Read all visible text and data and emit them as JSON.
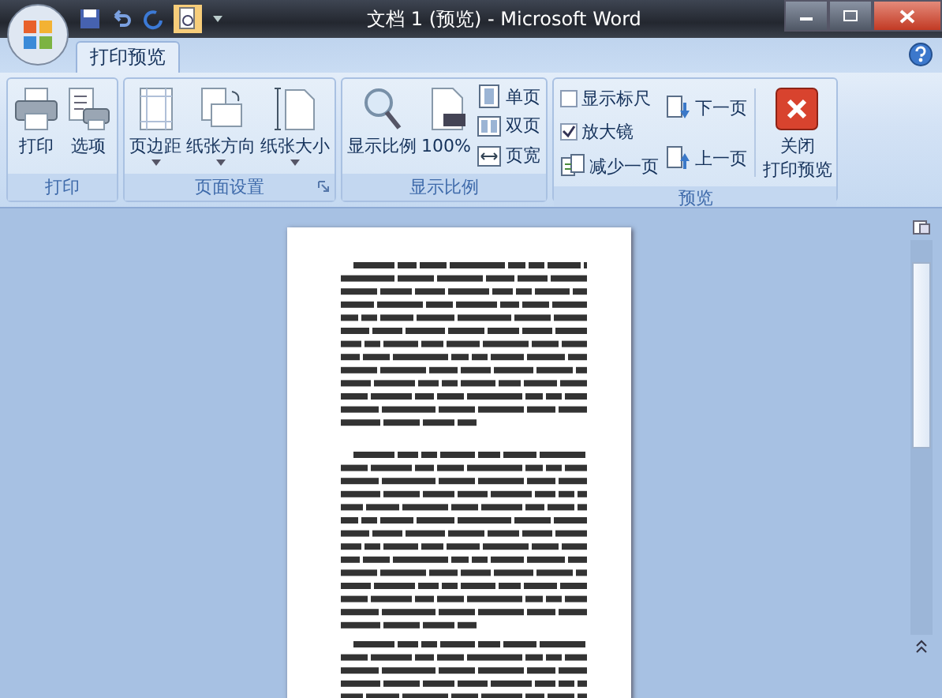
{
  "window": {
    "title": "文档 1 (预览) - Microsoft Word"
  },
  "tabs": [
    {
      "label": "打印预览",
      "selected": true
    }
  ],
  "groups": [
    {
      "label": "打印",
      "items": [
        {
          "kind": "big",
          "label": "打印"
        },
        {
          "kind": "big",
          "label": "选项"
        }
      ]
    },
    {
      "label": "页面设置",
      "items": [
        {
          "kind": "dropdown",
          "label": "页边距"
        },
        {
          "kind": "dropdown",
          "label": "纸张方向"
        },
        {
          "kind": "dropdown",
          "label": "纸张大小"
        }
      ]
    },
    {
      "label": "显示比例",
      "items": [
        {
          "kind": "big",
          "label": "显示比例"
        },
        {
          "kind": "big",
          "label": "100%"
        },
        {
          "kind": "stack",
          "items": [
            {
              "kind": "small",
              "label": "单页"
            },
            {
              "kind": "small",
              "label": "双页"
            },
            {
              "kind": "small",
              "label": "页宽"
            }
          ]
        }
      ]
    },
    {
      "label": "预览",
      "items": [
        {
          "kind": "stack",
          "items": [
            {
              "kind": "checkbox",
              "label": "显示标尺",
              "checked": false
            },
            {
              "kind": "checkbox",
              "label": "放大镜",
              "checked": true
            },
            {
              "kind": "small",
              "label": "减少一页"
            }
          ]
        },
        {
          "kind": "stack",
          "items": [
            {
              "kind": "small",
              "label": "下一页"
            },
            {
              "kind": "small",
              "label": "上一页"
            }
          ]
        },
        {
          "kind": "big",
          "lines": [
            "关闭",
            "打印预览"
          ]
        }
      ]
    }
  ]
}
